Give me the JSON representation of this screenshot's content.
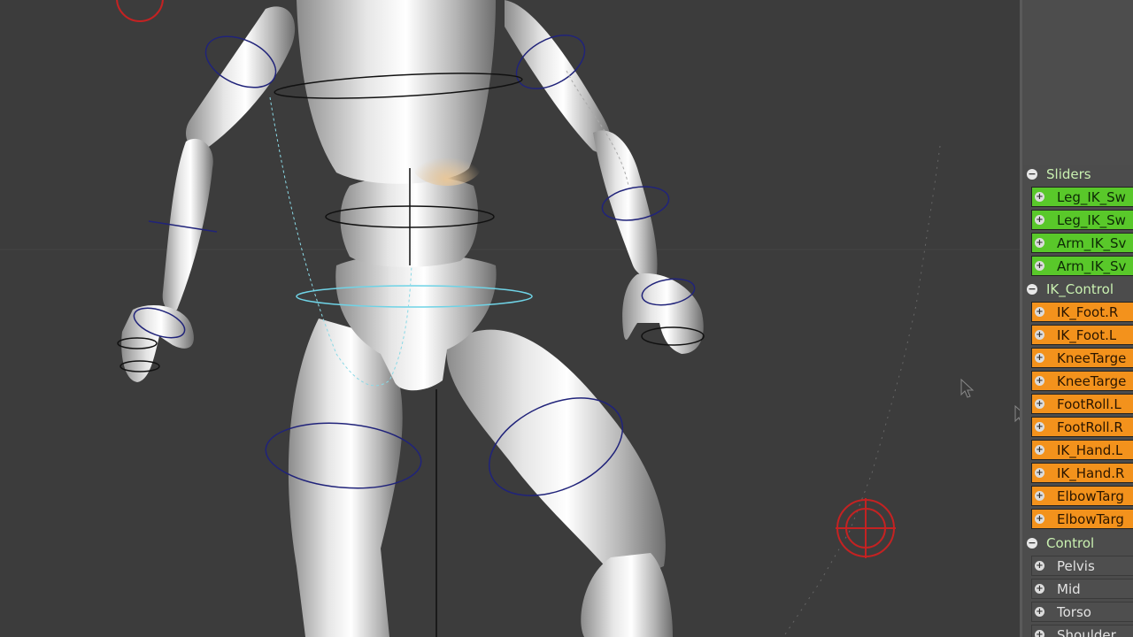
{
  "panel": {
    "groups": [
      {
        "label": "Sliders",
        "items": [
          "Leg_IK_Sw",
          "Leg_IK_Sw",
          "Arm_IK_Sv",
          "Arm_IK_Sv"
        ]
      },
      {
        "label": "IK_Control",
        "items": [
          "IK_Foot.R",
          "IK_Foot.L",
          "KneeTarge",
          "KneeTarge",
          "FootRoll.L",
          "FootRoll.R",
          "IK_Hand.L",
          "IK_Hand.R",
          "ElbowTarg",
          "ElbowTarg"
        ]
      },
      {
        "label": "Control",
        "items": [
          "Pelvis",
          "Mid",
          "Torso",
          "Shoulder"
        ]
      }
    ]
  },
  "colors": {
    "viewport_bg": "#3c3c3c",
    "sliders_items": "#59c82a",
    "ik_control_items": "#f3921c",
    "control_items": "#4e4e4e",
    "bone_circle": "#20237a",
    "selected_circle": "#6fd3e6",
    "target_marker": "#c42222"
  }
}
